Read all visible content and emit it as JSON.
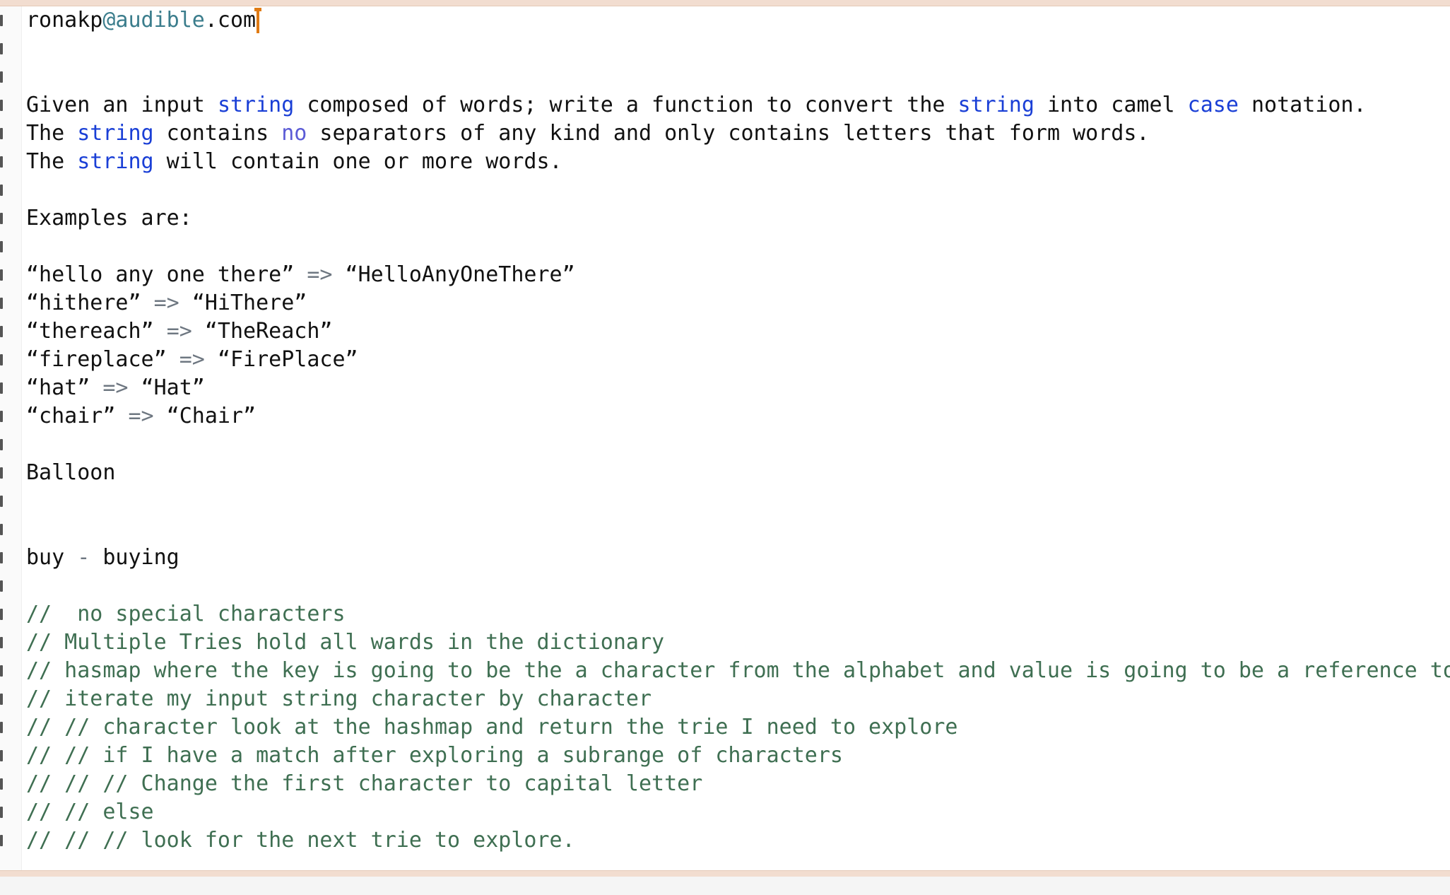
{
  "editor": {
    "line1": {
      "user": "ronakp",
      "domain": "@audible",
      "tld": ".com"
    },
    "line4": {
      "t1": "Given an input ",
      "kw1": "string",
      "t2": " composed of words; write a function to convert the ",
      "kw2": "string",
      "t3": " into camel ",
      "kw3": "case",
      "t4": " notation."
    },
    "line5": {
      "t1": "The ",
      "kw1": "string",
      "t2": " contains ",
      "kw2": "no",
      "t3": " separators of any kind and only contains letters that form words."
    },
    "line6": {
      "t1": "The ",
      "kw1": "string",
      "t2": " will contain one or more words."
    },
    "line8": "Examples are:",
    "examples": [
      {
        "input": "“hello any one there”",
        "arrow": "=>",
        "output": "“HelloAnyOneThere”"
      },
      {
        "input": "“hithere”",
        "arrow": "=>",
        "output": "“HiThere”"
      },
      {
        "input": "“thereach”",
        "arrow": "=>",
        "output": "“TheReach”"
      },
      {
        "input": "“fireplace”",
        "arrow": "=>",
        "output": "“FirePlace”"
      },
      {
        "input": "“hat”",
        "arrow": "=>",
        "output": "“Hat”"
      },
      {
        "input": "“chair”",
        "arrow": "=>",
        "output": "“Chair”"
      }
    ],
    "balloon": "Balloon",
    "buy": {
      "left": "buy",
      "dash": "-",
      "right": "buying"
    },
    "comments": [
      "//  no special characters",
      "// Multiple Tries hold all wards in the dictionary",
      "// hasmap where the key is going to be the a character from the alphabet and value is going to be a reference to",
      "// iterate my input string character by character",
      "// // character look at the hashmap and return the trie I need to explore",
      "// // if I have a match after exploring a subrange of characters",
      "// // // Change the first character to capital letter",
      "// // else",
      "// // // look for the next trie to explore."
    ]
  },
  "colors": {
    "keyword": "#1a3fd6",
    "comment": "#3f6f52",
    "cursor": "#e07b14",
    "text": "#111111"
  }
}
